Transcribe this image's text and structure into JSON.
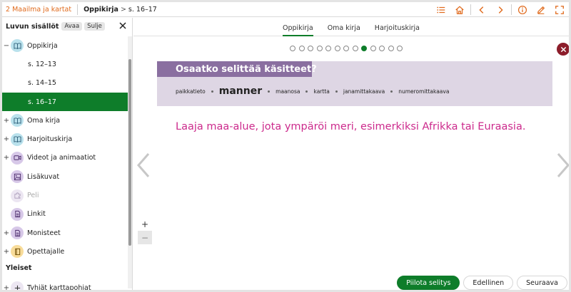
{
  "header": {
    "chapter": "2 Maailma ja kartat",
    "book": "Oppikirja",
    "pages": "s. 16–17",
    "colors": {
      "chapter": "#e06a1c",
      "accent": "#0e7d2a"
    },
    "icons": [
      "list-icon",
      "home-icon",
      "chevron-left-icon",
      "chevron-right-icon",
      "info-icon",
      "pen-icon",
      "fullscreen-icon"
    ]
  },
  "sidebar": {
    "title": "Luvun sisällöt",
    "open_label": "Avaa",
    "close_label": "Sulje",
    "items": [
      {
        "label": "Oppikirja",
        "expander": "−",
        "icon": "book-icon"
      },
      {
        "label": "s. 12–13"
      },
      {
        "label": "s. 14–15"
      },
      {
        "label": "s. 16–17"
      },
      {
        "label": "Oma kirja",
        "expander": "+",
        "icon": "book-icon"
      },
      {
        "label": "Harjoituskirja",
        "expander": "+",
        "icon": "book-icon"
      },
      {
        "label": "Videot ja animaatiot",
        "expander": "+",
        "icon": "video-icon"
      },
      {
        "label": "Lisäkuvat",
        "icon": "image-icon"
      },
      {
        "label": "Peli",
        "icon": "puzzle-icon"
      },
      {
        "label": "Linkit",
        "icon": "document-icon"
      },
      {
        "label": "Monisteet",
        "expander": "+",
        "icon": "document-icon"
      },
      {
        "label": "Opettajalle",
        "expander": "+",
        "icon": "teacher-book-icon"
      }
    ],
    "section_title": "Yleiset",
    "general_item": {
      "label": "Tyhjät karttapohjat",
      "expander": "+"
    }
  },
  "tabs": [
    {
      "label": "Oppikirja"
    },
    {
      "label": "Oma kirja"
    },
    {
      "label": "Harjoituskirja"
    }
  ],
  "slides": {
    "count": 13,
    "current": 9
  },
  "card": {
    "title": "Osaatko selittää käsitteet?",
    "terms": [
      "paikkatieto",
      "manner",
      "maanosa",
      "kartta",
      "janamittakaava",
      "numeromittakaava"
    ],
    "active_term": "manner",
    "definition": "Laaja maa-alue, jota ympäröi meri, esimerkiksi Afrikka tai Euraasia.",
    "colors": {
      "title_bg": "#8a6fa0",
      "card_bg": "#ded6e4",
      "definition": "#cc2a8c"
    }
  },
  "zoom": {
    "in_label": "+",
    "out_label": "−"
  },
  "buttons": {
    "hide": "Piilota selitys",
    "prev": "Edellinen",
    "next": "Seuraava"
  }
}
